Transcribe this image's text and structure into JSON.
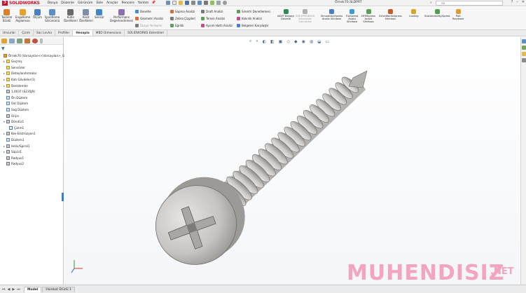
{
  "app": {
    "logo_prefix": "3DS",
    "logo_text": "SOLIDWORKS",
    "document_title": "Örnek70.SLDPRT",
    "search_text": "eo"
  },
  "menu": [
    "Dosya",
    "Düzenle",
    "Görünüm",
    "Ekle",
    "Araçlar",
    "Pencere",
    "Yardım"
  ],
  "commands": {
    "large": [
      {
        "id": "tasarim-etudu",
        "label": "Tasarım\nEtüdü",
        "color": "#d9822b"
      },
      {
        "id": "engelleme",
        "label": "Engelleme\nAlgılaması",
        "color": "#e4a32c"
      },
      {
        "id": "olcum",
        "label": "Ölçüm",
        "color": "#4a7fc1"
      },
      {
        "id": "isaretleme",
        "label": "İşaretleme\nGörünümü",
        "color": "#5b8fc7"
      },
      {
        "id": "kutle",
        "label": "Kütle\nÖzellikleri",
        "color": "#6b6b6b"
      },
      {
        "id": "kesit",
        "label": "Kesit\nÖzellikleri",
        "color": "#7d8fa8"
      },
      {
        "id": "sensor",
        "label": "Sensör",
        "color": "#3d89c9"
      },
      {
        "id": "performans",
        "label": "Performans\nDeğerlendirmesi",
        "color": "#8a6fb5"
      }
    ],
    "small_col1": [
      "Denetle",
      "Geometri Analizi",
      "Dosya Yerleşimi"
    ],
    "small_col2": [
      "Sapma Analizi",
      "Zebra Çizgileri",
      "Eğrilik"
    ],
    "small_col3": [
      "Draft Analizi",
      "Teraslı Analizi",
      "Ayırım Hattı Analizi"
    ],
    "small_col4": [
      "Simetri Denetlemesi",
      "Kalınlık Analizi",
      "Belgeleri Karşılaştır"
    ],
    "large2": [
      {
        "id": "akitr",
        "label": "AKHT Belgeyi\nDenetle",
        "color": "#2e8b57",
        "disabled": false
      },
      {
        "id": "3dexp",
        "label": "3DEXPERIENCE\nSimulation\nConnector",
        "color": "#b0b0b0",
        "disabled": true
      },
      {
        "id": "simxpress",
        "label": "SimulationXpress\nAnaliz Sihirbazı",
        "color": "#4a7fc1",
        "disabled": false
      },
      {
        "id": "floxpress",
        "label": "FloXpress\nAnaliz\nSihirbazı",
        "color": "#3b9bd6",
        "disabled": false
      },
      {
        "id": "dfmxpress",
        "label": "DFMXpress\nAnaliz\nSihirbazı",
        "color": "#5a9e5a",
        "disabled": false
      },
      {
        "id": "driveworks",
        "label": "DriveWorksXpress\nSihirbazı",
        "color": "#c75b2b",
        "disabled": false
      },
      {
        "id": "costing",
        "label": "Costing",
        "color": "#d6a52c",
        "disabled": false
      },
      {
        "id": "sustainability",
        "label": "SustainabilityXpress",
        "color": "#4f9f4f",
        "disabled": false
      },
      {
        "id": "partreviewer",
        "label": "Part\nReviewer",
        "color": "#e09b2d",
        "disabled": false
      }
    ]
  },
  "tabs": [
    "Unsurlar",
    "Çizim",
    "Sac Levha",
    "Profiller",
    "Hesapla",
    "MBD Dimensions",
    "SOLIDWORKS Eklentileri"
  ],
  "active_tab": "Hesapla",
  "tree": [
    {
      "label": "Örnek70  (Varsayılan<<Varsayılan>_Gö",
      "icon": "part",
      "indent": 0,
      "exp": ""
    },
    {
      "label": "Geçmiş",
      "icon": "fold",
      "indent": 1,
      "exp": "▸"
    },
    {
      "label": "Sensörler",
      "icon": "fold",
      "indent": 1,
      "exp": ""
    },
    {
      "label": "Detaylandırmalar",
      "icon": "fold",
      "indent": 1,
      "exp": "▸"
    },
    {
      "label": "Katı Gövdeler(1)",
      "icon": "fold",
      "indent": 1,
      "exp": "▸"
    },
    {
      "label": "Denklemler",
      "icon": "fold",
      "indent": 1,
      "exp": "▸"
    },
    {
      "label": "1.0037 (S235JR)",
      "icon": "feat",
      "indent": 1,
      "exp": ""
    },
    {
      "label": "Ön Düzlem",
      "icon": "plane",
      "indent": 1,
      "exp": ""
    },
    {
      "label": "Üst Düzlem",
      "icon": "plane",
      "indent": 1,
      "exp": ""
    },
    {
      "label": "Sağ Düzlem",
      "icon": "plane",
      "indent": 1,
      "exp": ""
    },
    {
      "label": "Orijin",
      "icon": "feat",
      "indent": 1,
      "exp": ""
    },
    {
      "label": "Döndür1",
      "icon": "feat",
      "indent": 1,
      "exp": "▾"
    },
    {
      "label": "Çizim1",
      "icon": "skt",
      "indent": 2,
      "exp": ""
    },
    {
      "label": "Kes-Ekstrüzyon1",
      "icon": "feat",
      "indent": 1,
      "exp": "▸"
    },
    {
      "label": "Düzlem1",
      "icon": "plane",
      "indent": 1,
      "exp": ""
    },
    {
      "label": "Helix/Spiral1",
      "icon": "feat",
      "indent": 1,
      "exp": "▸"
    },
    {
      "label": "Süpür1",
      "icon": "feat",
      "indent": 1,
      "exp": "▸"
    },
    {
      "label": "Radyus1",
      "icon": "feat",
      "indent": 1,
      "exp": ""
    },
    {
      "label": "Radyus2",
      "icon": "feat",
      "indent": 1,
      "exp": ""
    }
  ],
  "bottom_tabs": [
    "Model",
    "Hareket Etüdü 1"
  ],
  "active_bottom_tab": "Model",
  "watermark": {
    "main": "MUHENDISIZ",
    "suffix": ".NET"
  },
  "colors": {
    "brand": "#c8102e",
    "accent": "#3a7bd5",
    "screw_light": "#d6d4d2",
    "screw_dark": "#8b8986",
    "watermark": "#f3a4c3"
  }
}
